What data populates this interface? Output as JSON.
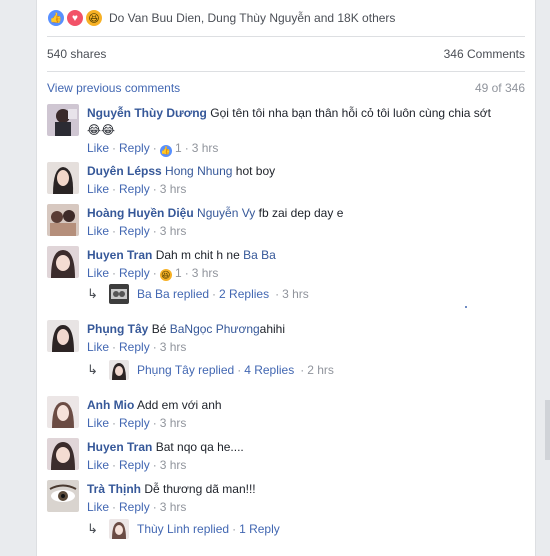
{
  "reactions": {
    "names": "Do Van Buu Dien, Dung Thùy Nguyễn and 18K others",
    "like_icon": "like-icon",
    "love_icon": "love-icon",
    "haha_icon": "haha-icon",
    "colors": {
      "like": "#5890ff",
      "love": "#f25268",
      "haha": "#f7b125"
    }
  },
  "stats": {
    "shares": "540 shares",
    "comments": "346 Comments"
  },
  "previous": {
    "label": "View previous comments",
    "count": "49 of 346"
  },
  "actions": {
    "like": "Like",
    "reply": "Reply"
  },
  "comments": [
    {
      "author": "Nguyễn Thùy Dương",
      "text": "Gọi tên tôi nha bạn thân hỗi cỏ tôi luôn cùng chia sớt",
      "emoji": "😂😂",
      "reaction_count": "1",
      "time": "3 hrs"
    },
    {
      "author": "Duyên Lépss",
      "mention": "Hong Nhung",
      "text": "hot boy",
      "time": "3 hrs"
    },
    {
      "author": "Hoàng Huyền Diệu",
      "mention": "Nguyễn Vy",
      "text": "fb zai dep day e",
      "time": "3 hrs"
    },
    {
      "author": "Huyen Tran",
      "text": "Dah m chit h ne",
      "mention": "Ba Ba",
      "reaction_count": "1",
      "time": "3 hrs",
      "replies": {
        "name": "Ba Ba replied",
        "count": "2 Replies",
        "time": "3 hrs"
      }
    },
    {
      "author": "Phụng Tây",
      "text_before": "Bé",
      "mention": "BaNgọc Phương",
      "text": "ahihi",
      "time": "3 hrs",
      "replies": {
        "name": "Phụng Tây replied",
        "count": "4 Replies",
        "time": "2 hrs"
      }
    },
    {
      "author": "Anh Mio",
      "text": "Add em với anh",
      "time": "3 hrs"
    },
    {
      "author": "Huyen Tran",
      "text": "Bat nqo qa he....",
      "time": "3 hrs"
    },
    {
      "author": "Trà Thịnh",
      "text": "Dễ thương dã man!!!",
      "time": "3 hrs",
      "replies": {
        "name": "Thùy Linh replied",
        "count": "1 Reply"
      }
    }
  ]
}
